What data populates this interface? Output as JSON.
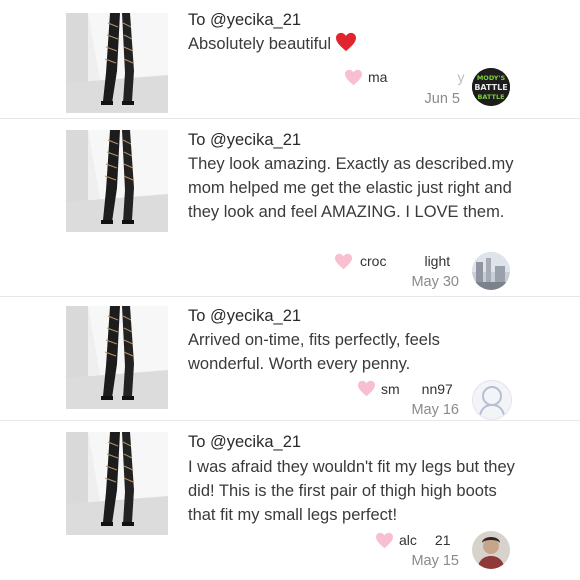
{
  "reviews": [
    {
      "to": "To @yecika_21",
      "message": "Absolutely beautiful",
      "has_heart_emoji": true,
      "username_start": "ma",
      "username_end": "y",
      "date": "Jun 5",
      "avatar": "battle-logo",
      "avatar_text": [
        "MODY'S",
        "BATTLE",
        "BATTLE"
      ]
    },
    {
      "to": "To @yecika_21",
      "message": "They look amazing. Exactly as described.my mom helped me get the elastic just right and they look and feel AMAZING. I LOVE them.",
      "username_start": "croc",
      "username_end": "light",
      "date": "May 30",
      "avatar": "photo-landscape"
    },
    {
      "to": "To @yecika_21",
      "message": "Arrived on-time, fits perfectly, feels wonderful. Worth every penny.",
      "username_start": "sm",
      "username_end": "nn97",
      "date": "May 16",
      "avatar": "default-person"
    },
    {
      "to": "To @yecika_21",
      "message": "I was afraid they wouldn't fit my legs but they did! This is the first pair of thigh high boots that fit my small legs perfect!",
      "username_start": "alc",
      "username_end": "21",
      "date": "May 15",
      "avatar": "photo-person"
    }
  ],
  "colors": {
    "like_heart": "#f7bfcf",
    "emoji_heart": "#e0252e",
    "date": "#8a8a8a"
  },
  "icons": {
    "like": "heart-icon",
    "emoji": "red-heart-emoji"
  }
}
